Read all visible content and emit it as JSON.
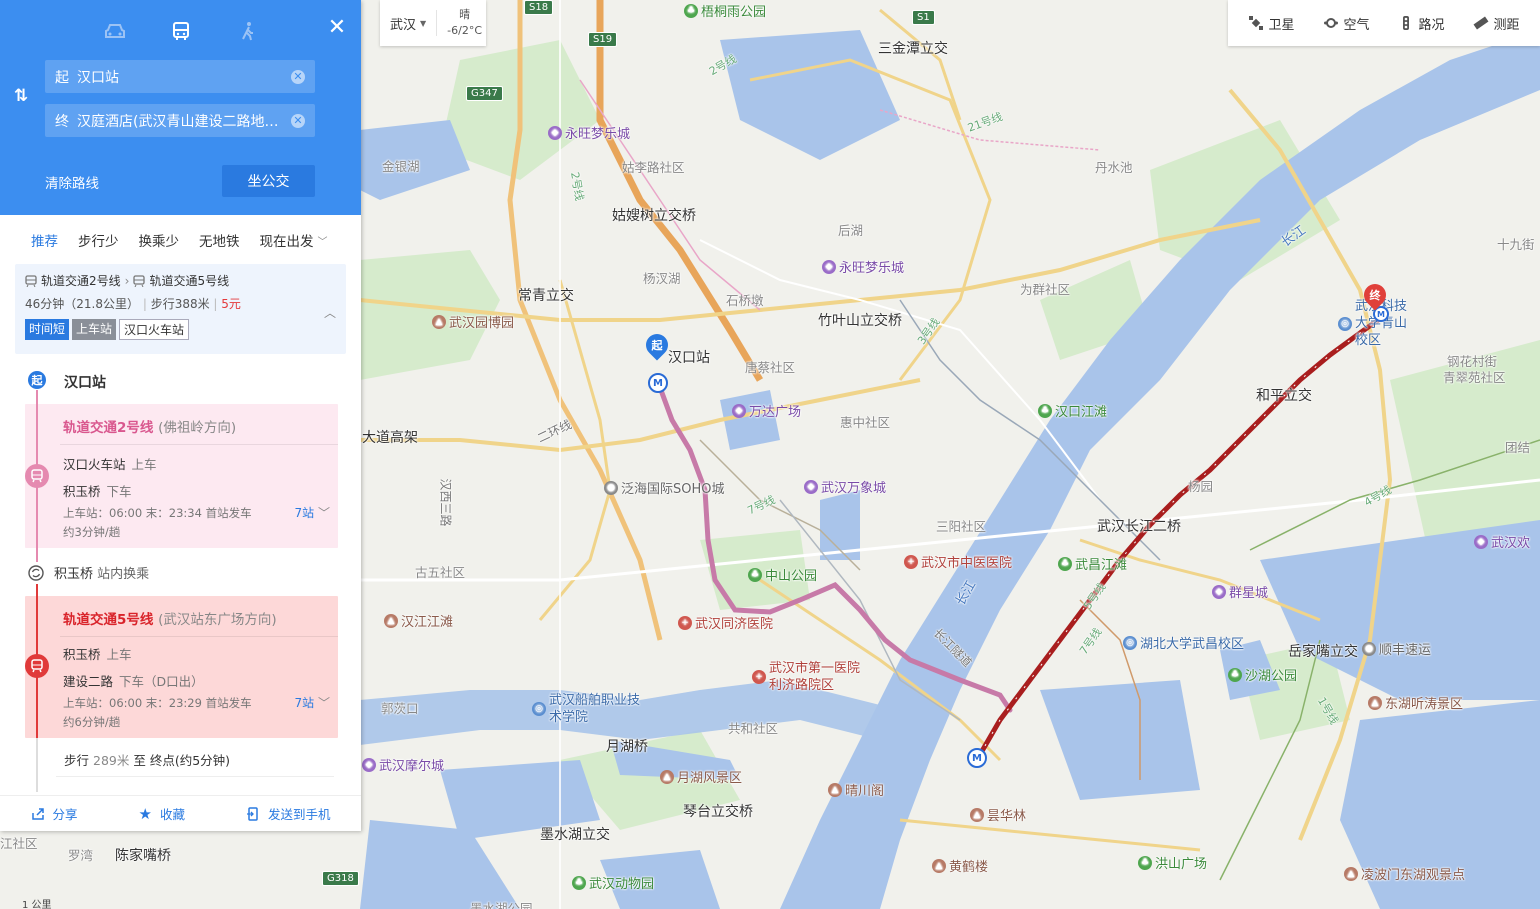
{
  "map": {
    "labels": [
      {
        "text": "三金潭立交",
        "cls": "big"
      },
      {
        "text": "金银湖",
        "cls": "dist"
      },
      {
        "text": "姑嫂树立交桥",
        "cls": "big"
      },
      {
        "text": "常青立交",
        "cls": "big"
      },
      {
        "text": "杨汊湖",
        "cls": "dist"
      },
      {
        "text": "后湖",
        "cls": "dist"
      },
      {
        "text": "丹水池",
        "cls": "dist"
      },
      {
        "text": "竹叶山立交桥",
        "cls": "big"
      },
      {
        "text": "石桥墩",
        "cls": "dist"
      },
      {
        "text": "唐蔡社区",
        "cls": "dist"
      },
      {
        "text": "惠中社区",
        "cls": "dist"
      },
      {
        "text": "为群社区",
        "cls": "dist"
      },
      {
        "text": "大道高架",
        "cls": "big"
      },
      {
        "text": "三阳社区",
        "cls": "dist"
      },
      {
        "text": "古五社区",
        "cls": "dist"
      },
      {
        "text": "武汉长江二桥",
        "cls": "big"
      },
      {
        "text": "和平立交",
        "cls": "big"
      },
      {
        "text": "杨园",
        "cls": "dist"
      },
      {
        "text": "钢花村街",
        "cls": "dist"
      },
      {
        "text": "青翠苑社区",
        "cls": "dist"
      },
      {
        "text": "岳家嘴立交",
        "cls": "big"
      },
      {
        "text": "郭茨口",
        "cls": "dist"
      },
      {
        "text": "共和社区",
        "cls": "dist"
      },
      {
        "text": "月湖桥",
        "cls": "big"
      },
      {
        "text": "琴台立交桥",
        "cls": "big"
      },
      {
        "text": "墨水湖立交",
        "cls": "big"
      },
      {
        "text": "罗湾",
        "cls": "dist"
      },
      {
        "text": "陈家嘴桥",
        "cls": "big"
      },
      {
        "text": "长江",
        "cls": "water"
      },
      {
        "text": "长江隧道",
        "cls": "road"
      },
      {
        "text": "长江",
        "cls": "water"
      },
      {
        "text": "二环线",
        "cls": "road"
      },
      {
        "text": "汉西三路",
        "cls": "road"
      },
      {
        "text": "姑李路社区",
        "cls": "dist"
      },
      {
        "text": "十九街",
        "cls": "dist"
      },
      {
        "text": "团结",
        "cls": "dist"
      },
      {
        "text": "江社区",
        "cls": "dist"
      },
      {
        "text": "墨水湖公园",
        "cls": "dist"
      },
      {
        "text": "2号线",
        "cls": "route"
      },
      {
        "text": "2号线",
        "cls": "route"
      },
      {
        "text": "21号线",
        "cls": "route"
      },
      {
        "text": "3号线",
        "cls": "route"
      },
      {
        "text": "7号线",
        "cls": "route"
      },
      {
        "text": "7号线",
        "cls": "route"
      },
      {
        "text": "4号线",
        "cls": "route"
      },
      {
        "text": "5号线",
        "cls": "route"
      },
      {
        "text": "1号线",
        "cls": "route"
      }
    ],
    "pois": [
      {
        "text": "梧桐雨公园",
        "cls": "green"
      },
      {
        "text": "永旺梦乐城",
        "cls": "purple"
      },
      {
        "text": "永旺梦乐城",
        "cls": "purple"
      },
      {
        "text": "武汉园博园",
        "cls": "brown"
      },
      {
        "text": "万达广场",
        "cls": "purple"
      },
      {
        "text": "汉口江滩",
        "cls": "green"
      },
      {
        "text": "泛海国际SOHO城",
        "cls": "gray"
      },
      {
        "text": "武汉万象城",
        "cls": "purple"
      },
      {
        "text": "武汉市中医医院",
        "cls": "red"
      },
      {
        "text": "武昌江滩",
        "cls": "green"
      },
      {
        "text": "中山公园",
        "cls": "green"
      },
      {
        "text": "群星城",
        "cls": "purple"
      },
      {
        "text": "武汉同济医院",
        "cls": "red"
      },
      {
        "text": "湖北大学武昌校区",
        "cls": "blue"
      },
      {
        "text": "汉江江滩",
        "cls": "brown"
      },
      {
        "text": "武汉市第一医院利济路院区",
        "cls": "red"
      },
      {
        "text": "沙湖公园",
        "cls": "green"
      },
      {
        "text": "武汉船舶职业技术学院",
        "cls": "blue"
      },
      {
        "text": "顺丰速运",
        "cls": "gray"
      },
      {
        "text": "东湖听涛景区",
        "cls": "brown"
      },
      {
        "text": "月湖风景区",
        "cls": "brown"
      },
      {
        "text": "晴川阁",
        "cls": "brown"
      },
      {
        "text": "武汉摩尔城",
        "cls": "purple"
      },
      {
        "text": "昙华林",
        "cls": "brown"
      },
      {
        "text": "黄鹤楼",
        "cls": "brown"
      },
      {
        "text": "洪山广场",
        "cls": "green"
      },
      {
        "text": "武汉动物园",
        "cls": "green"
      },
      {
        "text": "凌波门东湖观景点",
        "cls": "brown"
      },
      {
        "text": "武汉欢",
        "cls": "purple"
      },
      {
        "text": "武汉科技大学青山校区",
        "cls": "blue"
      }
    ],
    "shields": [
      "S18",
      "S1",
      "S19",
      "G347",
      "G318"
    ],
    "start_pin": "起",
    "start_station": "汉口站",
    "end_pin": "终",
    "scale_text": "1 公里"
  },
  "city_box": {
    "city": "武汉",
    "weather_state": "晴",
    "temperature": "-6/2°C"
  },
  "toolbar": [
    {
      "label": "卫星",
      "icon": "satellite-icon"
    },
    {
      "label": "空气",
      "icon": "air-icon"
    },
    {
      "label": "路况",
      "icon": "traffic-icon"
    },
    {
      "label": "测距",
      "icon": "ruler-icon"
    }
  ],
  "panel": {
    "modes": [
      {
        "name": "car",
        "icon": "car-icon"
      },
      {
        "name": "bus",
        "icon": "bus-icon"
      },
      {
        "name": "walk",
        "icon": "walk-icon"
      }
    ],
    "start": {
      "tag": "起",
      "value": "汉口站"
    },
    "end": {
      "tag": "终",
      "value": "汉庭酒店(武汉青山建设二路地铁站店)"
    },
    "clear_route": "清除路线",
    "bus_button": "坐公交",
    "filters": [
      "推荐",
      "步行少",
      "换乘少",
      "无地铁",
      "现在出发"
    ],
    "plan": {
      "line1": "轨道交通2号线",
      "line2": "轨道交通5号线",
      "meta_time": "46分钟（21.8公里）",
      "meta_walk": "步行388米",
      "price": "5元",
      "tags": [
        "时间短",
        "上车站",
        "汉口火车站"
      ]
    },
    "steps": {
      "start_badge": "起",
      "start_name": "汉口站",
      "seg1": {
        "line": "轨道交通2号线",
        "dir": "(佛祖岭方向)",
        "board": "汉口火车站",
        "board_act": "上车",
        "alight": "积玉桥",
        "alight_act": "下车",
        "times": "上车站：06:00  末：23:34  首站发车",
        "freq": "约3分钟/趟",
        "stops": "7站"
      },
      "transfer": "积玉桥",
      "transfer_note": "站内换乘",
      "seg2": {
        "line": "轨道交通5号线",
        "dir": "(武汉站东广场方向)",
        "board": "积玉桥",
        "board_act": "上车",
        "alight": "建设二路",
        "alight_act": "下车（D口出）",
        "times": "上车站：06:00  末：23:29  首站发车",
        "freq": "约6分钟/趟",
        "stops": "7站"
      },
      "walk_prefix": "步行",
      "walk_dist": "289米",
      "walk_suffix": "至 终点(约5分钟)"
    },
    "actions": [
      "分享",
      "收藏",
      "发送到手机"
    ]
  },
  "colors": {
    "header_blue": "#3c8ef0",
    "line2_pink": "#e58ab0",
    "line5_red": "#e03a3a",
    "route_dark_red": "#b01c1c",
    "river": "#a9c4ea"
  }
}
